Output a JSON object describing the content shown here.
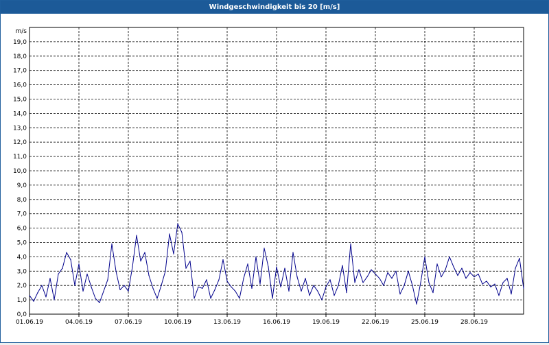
{
  "window": {
    "title": "Windgeschwindigkeit bis 20 [m/s]"
  },
  "chart_data": {
    "type": "line",
    "title": "Windgeschwindigkeit bis 20 [m/s]",
    "ylabel": "m/s",
    "ylim": [
      0,
      20
    ],
    "yticks": [
      "0,0",
      "1,0",
      "2,0",
      "3,0",
      "4,0",
      "5,0",
      "6,0",
      "7,0",
      "8,0",
      "9,0",
      "10,0",
      "11,0",
      "12,0",
      "13,0",
      "14,0",
      "15,0",
      "16,0",
      "17,0",
      "18,0",
      "19,0"
    ],
    "xticks": [
      "01.06.19",
      "04.06.19",
      "07.06.19",
      "10.06.19",
      "13.06.19",
      "16.06.19",
      "19.06.19",
      "22.06.19",
      "25.06.19",
      "28.06.19"
    ],
    "xrange_days": [
      0,
      30.0
    ],
    "grid": true,
    "line_color": "#00008b",
    "series": [
      {
        "x": [
          0,
          0.25,
          0.5,
          0.75,
          1,
          1.25,
          1.5,
          1.75,
          2,
          2.25,
          2.5,
          2.75,
          3,
          3.25,
          3.5,
          3.75,
          4,
          4.25,
          4.5,
          4.75,
          5,
          5.25,
          5.5,
          5.75,
          6,
          6.25,
          6.5,
          6.75,
          7,
          7.25,
          7.5,
          7.75,
          8,
          8.25,
          8.5,
          8.75,
          9,
          9.25,
          9.5,
          9.75,
          10,
          10.25,
          10.5,
          10.75,
          11,
          11.25,
          11.5,
          11.75,
          12,
          12.25,
          12.5,
          12.75,
          13,
          13.25,
          13.5,
          13.75,
          14,
          14.25,
          14.5,
          14.75,
          15,
          15.25,
          15.5,
          15.75,
          16,
          16.25,
          16.5,
          16.75,
          17,
          17.25,
          17.5,
          17.75,
          18,
          18.25,
          18.5,
          18.75,
          19,
          19.25,
          19.5,
          19.75,
          20,
          20.25,
          20.5,
          20.75,
          21,
          21.25,
          21.5,
          21.75,
          22,
          22.25,
          22.5,
          22.75,
          23,
          23.25,
          23.5,
          23.75,
          24,
          24.25,
          24.5,
          24.75,
          25,
          25.25,
          25.5,
          25.75,
          26,
          26.25,
          26.5,
          26.75,
          27,
          27.25,
          27.5,
          27.75,
          28,
          28.25,
          28.5,
          28.75,
          29,
          29.25,
          29.5,
          29.75,
          30.0
        ],
        "values": [
          1.3,
          0.9,
          1.5,
          2.0,
          1.2,
          2.5,
          1.0,
          2.8,
          3.2,
          4.3,
          3.8,
          2.0,
          3.5,
          1.6,
          2.8,
          1.9,
          1.1,
          0.8,
          1.6,
          2.4,
          4.9,
          3.0,
          1.7,
          2.0,
          1.6,
          3.3,
          5.5,
          3.7,
          4.3,
          2.7,
          1.8,
          1.1,
          2.0,
          3.0,
          5.6,
          4.2,
          6.3,
          5.7,
          3.2,
          3.7,
          1.1,
          1.9,
          1.8,
          2.4,
          1.1,
          1.7,
          2.4,
          3.8,
          2.3,
          1.9,
          1.6,
          1.1,
          2.5,
          3.5,
          1.8,
          4.0,
          2.1,
          4.6,
          3.3,
          1.1,
          3.3,
          1.9,
          3.2,
          1.6,
          4.3,
          2.6,
          1.6,
          2.5,
          1.3,
          2.0,
          1.6,
          1.0,
          1.9,
          2.4,
          1.3,
          2.0,
          3.4,
          1.5,
          4.9,
          2.2,
          3.1,
          2.2,
          2.6,
          3.1,
          2.8,
          2.5,
          2.0,
          2.9,
          2.5,
          3.0,
          1.4,
          2.0,
          3.0,
          2.0,
          0.7,
          2.2,
          4.0,
          2.2,
          1.5,
          3.5,
          2.6,
          3.1,
          4.0,
          3.3,
          2.7,
          3.2,
          2.5,
          2.9,
          2.6,
          2.8,
          2.1,
          2.3,
          1.9,
          2.1,
          1.3,
          2.2,
          2.5,
          1.4,
          3.2,
          3.9,
          1.8
        ]
      }
    ]
  }
}
